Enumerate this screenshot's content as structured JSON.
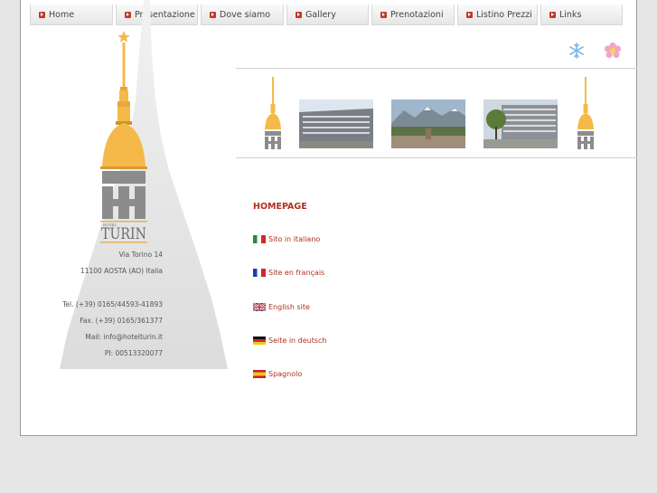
{
  "nav": {
    "items": [
      {
        "label": "Home",
        "width": 92
      },
      {
        "label": "Presentazione",
        "width": 91
      },
      {
        "label": "Dove siamo",
        "width": 92
      },
      {
        "label": "Gallery",
        "width": 91
      },
      {
        "label": "Prenotazioni",
        "width": 92
      },
      {
        "label": "Listino Prezzi",
        "width": 89
      },
      {
        "label": "Links",
        "width": 91
      }
    ]
  },
  "logo": {
    "text": "TURIN",
    "small_text": "HOTEL"
  },
  "contact": {
    "street": "Via Torino 14",
    "city": "11100 AOSTA (AO) Italia",
    "tel": "Tel. (+39) 0165/44593-41893",
    "fax": "Fax. (+39) 0165/361377",
    "mail": "Mail: info@hotelturin.it",
    "pi": "PI: 00513320077"
  },
  "main": {
    "title": "HOMEPAGE",
    "languages": [
      {
        "label": "Sito in italiano",
        "flag": "italy-flag"
      },
      {
        "label": "Site en français",
        "flag": "france-flag"
      },
      {
        "label": "English site",
        "flag": "uk-flag"
      },
      {
        "label": "Seite in deutsch",
        "flag": "germany-flag"
      },
      {
        "label": "Spagnolo",
        "flag": "spain-flag"
      }
    ]
  },
  "colors": {
    "accent": "#b0301c",
    "dome": "#f5b94a",
    "logo_gray": "#8c8c8c"
  }
}
